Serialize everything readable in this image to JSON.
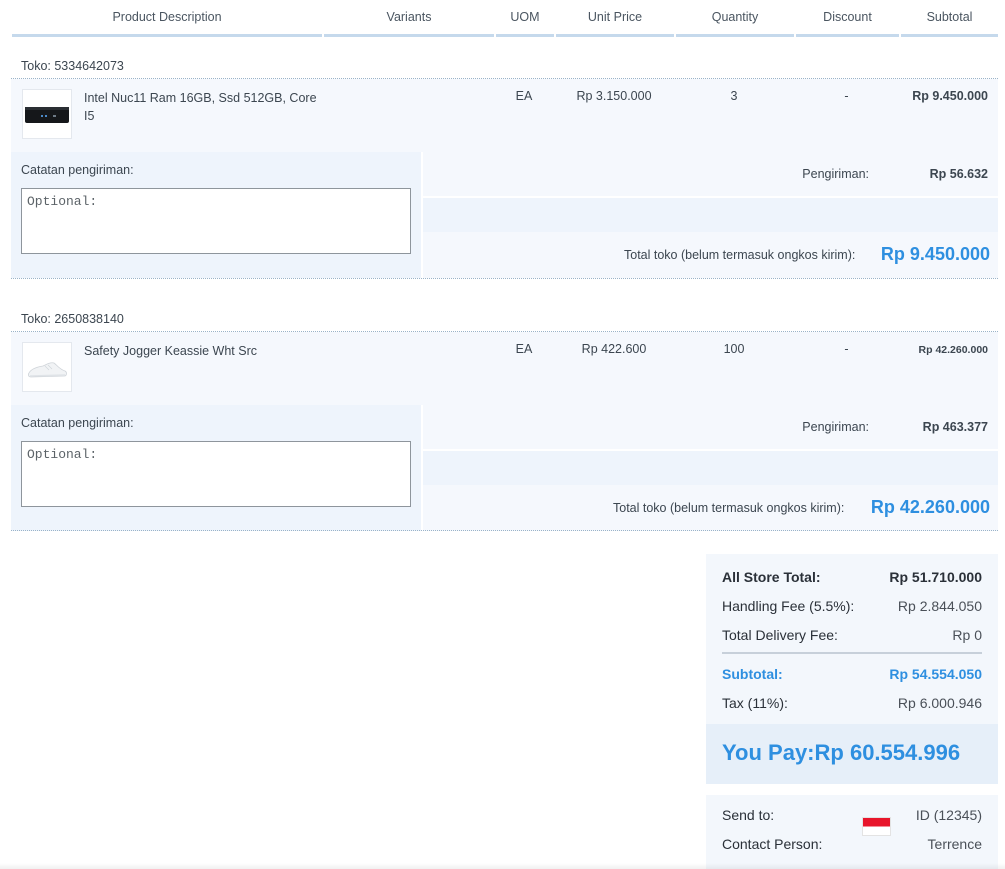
{
  "table": {
    "headers": [
      "Product Description",
      "Variants",
      "UOM",
      "Unit Price",
      "Quantity",
      "Discount",
      "Subtotal"
    ]
  },
  "stores": [
    {
      "label": "Toko: 5334642073",
      "item": {
        "name": "Intel Nuc11 Ram 16GB, Ssd 512GB, Core I5",
        "image_icon": "mini-pc-image",
        "uom": "EA",
        "unit_price": "Rp 3.150.000",
        "quantity": "3",
        "discount": "-",
        "subtotal": "Rp 9.450.000"
      },
      "notes_label": "Catatan pengiriman:",
      "notes_placeholder": "Optional:",
      "shipping_label": "Pengiriman:",
      "shipping_value": "Rp 56.632",
      "total_label": "Total toko (belum termasuk ongkos kirim):",
      "total_value": "Rp 9.450.000"
    },
    {
      "label": "Toko: 2650838140",
      "item": {
        "name": "Safety Jogger Keassie Wht Src",
        "image_icon": "white-shoe-image",
        "uom": "EA",
        "unit_price": "Rp 422.600",
        "quantity": "100",
        "discount": "-",
        "subtotal": "Rp 42.260.000"
      },
      "notes_label": "Catatan pengiriman:",
      "notes_placeholder": "Optional:",
      "shipping_label": "Pengiriman:",
      "shipping_value": "Rp 463.377",
      "total_label": "Total toko (belum termasuk ongkos kirim):",
      "total_value": "Rp 42.260.000"
    }
  ],
  "summary": {
    "all_store_total_label": "All Store Total:",
    "all_store_total_value": "Rp 51.710.000",
    "handling_fee_label": "Handling Fee (5.5%):",
    "handling_fee_value": "Rp 2.844.050",
    "delivery_fee_label": "Total Delivery Fee:",
    "delivery_fee_value": "Rp 0",
    "subtotal_label": "Subtotal:",
    "subtotal_value": "Rp 54.554.050",
    "tax_label": "Tax (11%):",
    "tax_value": "Rp 6.000.946",
    "you_pay_label": "You Pay:",
    "you_pay_value": "Rp 60.554.996",
    "send_to_label": "Send to:",
    "send_to_value": "ID (12345)",
    "send_to_flag": "indonesia-flag-icon",
    "contact_label": "Contact Person:",
    "contact_value": "Terrence"
  },
  "colors": {
    "accent": "#2e8fe0",
    "header_border": "#c5d9ec",
    "row_bg": "#f5f8fd",
    "notes_bg": "#eef4fc",
    "pay_bg": "#e6eff9"
  }
}
